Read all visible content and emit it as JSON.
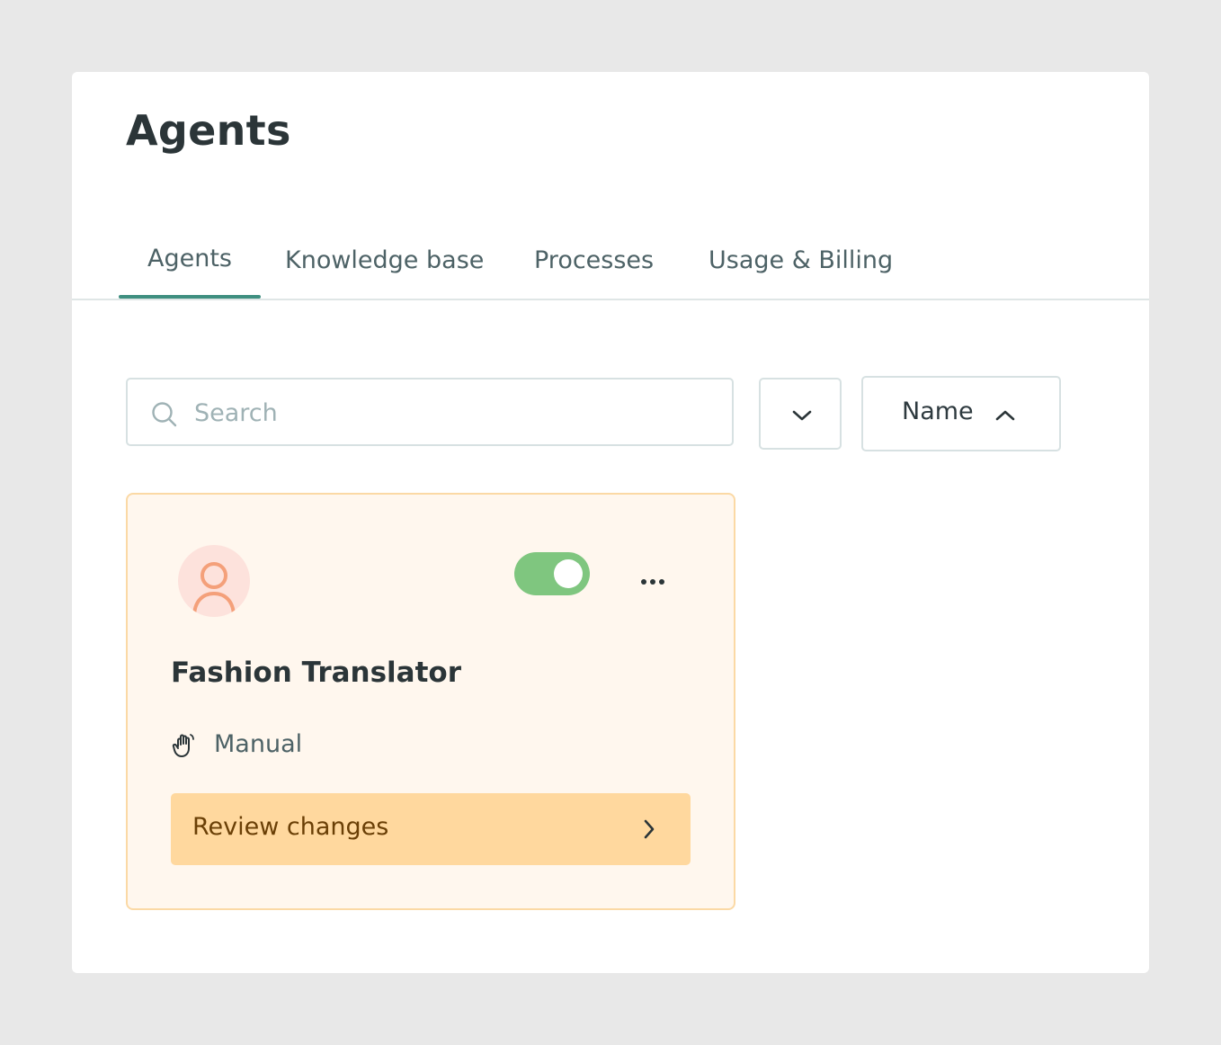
{
  "page": {
    "title": "Agents"
  },
  "tabs": [
    {
      "label": "Agents",
      "active": true
    },
    {
      "label": "Knowledge base",
      "active": false
    },
    {
      "label": "Processes",
      "active": false
    },
    {
      "label": "Usage & Billing",
      "active": false
    }
  ],
  "toolbar": {
    "search_placeholder": "Search",
    "search_value": "",
    "filter_icon": "chevron-down-icon",
    "sort_label": "Name",
    "sort_icon": "chevron-up-icon"
  },
  "agents": [
    {
      "name": "Fashion Translator",
      "avatar_icon": "user-icon",
      "enabled": true,
      "mode_label": "Manual",
      "mode_icon": "hand-icon",
      "action_label": "Review changes",
      "action_icon": "chevron-right-icon"
    }
  ],
  "colors": {
    "accent": "#3f8f80",
    "toggle_on": "#7fc67f",
    "card_bg": "#fff7ee",
    "card_border": "#fbd9a5",
    "action_bg": "#ffd89e",
    "avatar_bg": "#fde2dc",
    "avatar_icon": "#f4a07a"
  }
}
